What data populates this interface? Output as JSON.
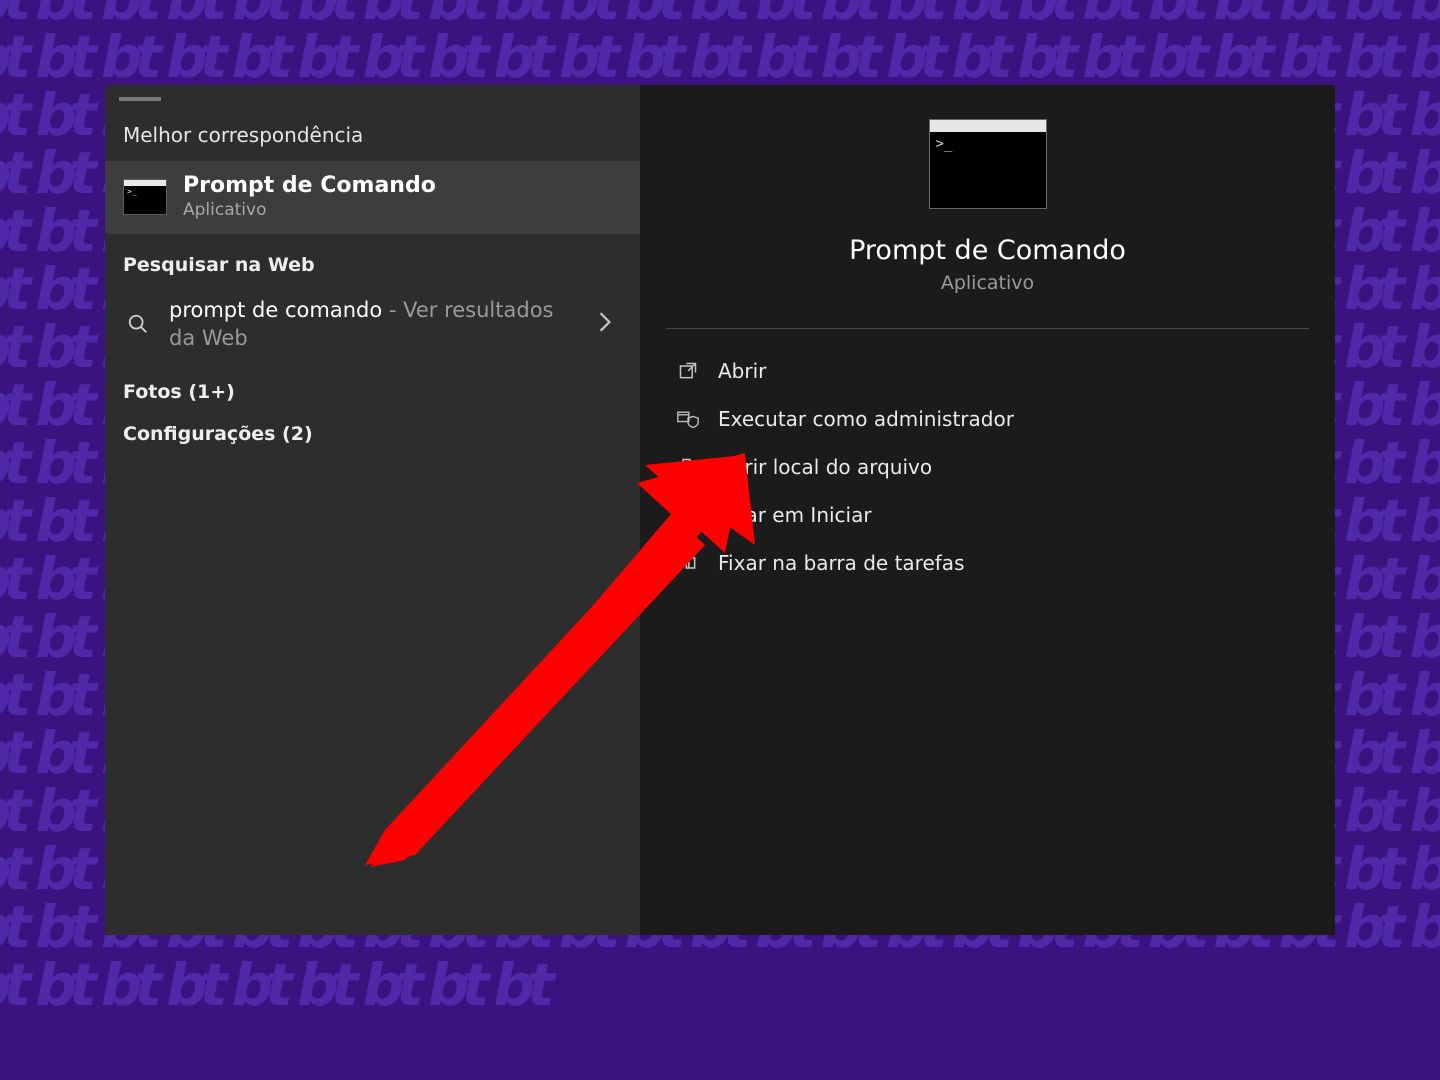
{
  "left": {
    "best_match_header": "Melhor correspondência",
    "best_match": {
      "title": "Prompt de Comando",
      "subtitle": "Aplicativo"
    },
    "web_header": "Pesquisar na Web",
    "web_item": {
      "query": "prompt de comando",
      "suffix": " - Ver resultados da Web"
    },
    "photos_header": "Fotos (1+)",
    "settings_header": "Configurações (2)"
  },
  "preview": {
    "title": "Prompt de Comando",
    "subtitle": "Aplicativo",
    "actions": {
      "open": "Abrir",
      "run_admin": "Executar como administrador",
      "open_location": "Abrir local do arquivo",
      "pin_start": "Fixar em Iniciar",
      "pin_taskbar": "Fixar na barra de tarefas"
    }
  }
}
